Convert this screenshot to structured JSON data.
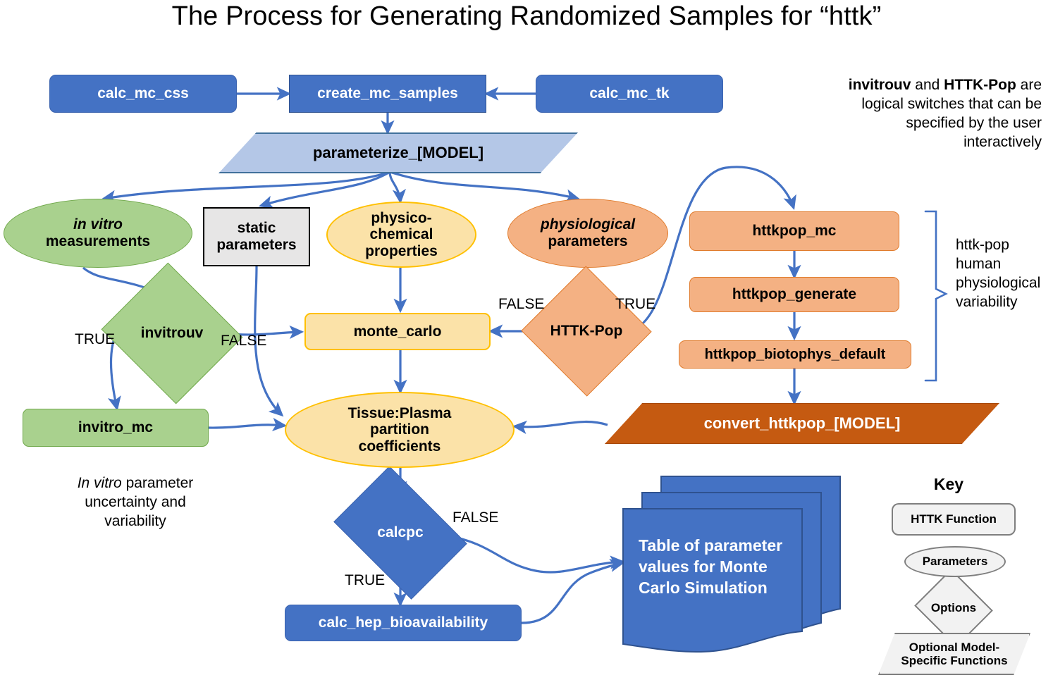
{
  "title": "The Process for Generating Randomized Samples for “httk”",
  "colors": {
    "httk_function_blue": "#4472C4",
    "optional_model_blue": "#B4C7E7",
    "in_vitro_green": "#A9D18E",
    "parameters_yellow": "#FBE2A8",
    "yellow_border": "#FFC000",
    "physiological_orange": "#F4B183",
    "convert_dark_orange": "#C55A11",
    "static_grey": "#E7E6E6",
    "arrow_blue": "#4472C4",
    "key_grey": "#F2F2F2"
  },
  "nodes": {
    "calc_mc_css": "calc_mc_css",
    "create_mc_samples": "create_mc_samples",
    "calc_mc_tk": "calc_mc_tk",
    "parameterize_model": "parameterize_[MODEL]",
    "in_vitro_measurements_line1": "in vitro",
    "in_vitro_measurements_line2": "measurements",
    "static_parameters_line1": "static",
    "static_parameters_line2": "parameters",
    "physico_chemical_line1": "physico-",
    "physico_chemical_line2": "chemical",
    "physico_chemical_line3": "properties",
    "physiological_line1": "physiological",
    "physiological_line2": "parameters",
    "httkpop_mc": "httkpop_mc",
    "httkpop_generate": "httkpop_generate",
    "httkpop_biotophys_default": "httkpop_biotophys_default",
    "invitrouv": "invitrouv",
    "monte_carlo": "monte_carlo",
    "httk_pop": "HTTK-Pop",
    "invitro_mc": "invitro_mc",
    "tissue_plasma_line1": "Tissue:Plasma",
    "tissue_plasma_line2": "partition",
    "tissue_plasma_line3": "coefficients",
    "convert_httkpop_model": "convert_httkpop_[MODEL]",
    "calcpc": "calcpc",
    "calc_hep_bioavailability": "calc_hep_bioavailability",
    "table_line1": "Table of parameter",
    "table_line2": "values for Monte",
    "table_line3": "Carlo Simulation"
  },
  "edge_labels": {
    "invitrouv_true": "TRUE",
    "invitrouv_false": "FALSE",
    "httkpop_false": "FALSE",
    "httkpop_true": "TRUE",
    "calcpc_false": "FALSE",
    "calcpc_true": "TRUE"
  },
  "annotations": {
    "switches_note": {
      "line1_bold_a": "invitrouv",
      "line1_mid": " and ",
      "line1_bold_b": "HTTK-Pop",
      "line1_tail": " are",
      "line2": "logical switches that can be",
      "line3": "specified by the user",
      "line4": "interactively"
    },
    "httkpop_bracket": {
      "line1": "httk-pop",
      "line2": "human",
      "line3": "physiological",
      "line4": "variability"
    },
    "in_vitro_note": {
      "line1_italic": "In vitro",
      "line1_tail": " parameter",
      "line2": "uncertainty and",
      "line3": "variability"
    }
  },
  "key": {
    "title": "Key",
    "httk_function": "HTTK Function",
    "parameters": "Parameters",
    "options": "Options",
    "optional_model_line1": "Optional Model-",
    "optional_model_line2": "Specific Functions"
  }
}
